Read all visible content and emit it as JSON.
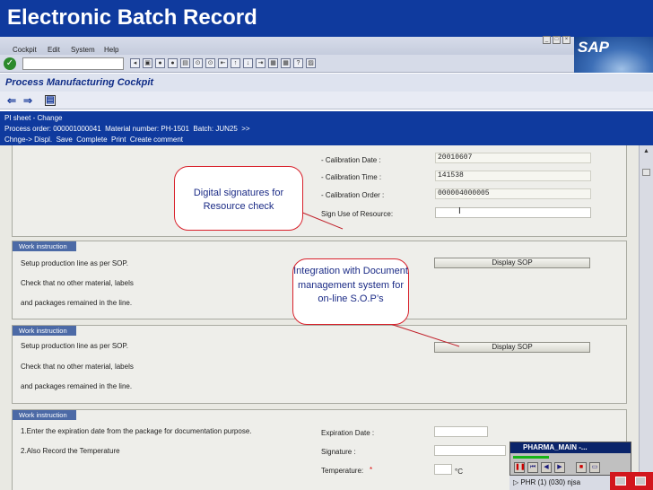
{
  "slide": {
    "title": "Electronic Batch Record"
  },
  "menu": {
    "items": [
      "Cockpit",
      "Edit",
      "System",
      "Help"
    ]
  },
  "logo": {
    "text": "SAP"
  },
  "toolbar": {
    "enter_icon": "check-icon",
    "icons": [
      "back-icon",
      "save-icon",
      "exit-icon",
      "cancel-icon",
      "print-icon",
      "find-icon",
      "find-next-icon",
      "first-page-icon",
      "prev-page-icon",
      "next-page-icon",
      "last-page-icon",
      "new-session-icon",
      "shortcut-icon",
      "help-icon",
      "layout-icon"
    ]
  },
  "app": {
    "title": "Process Manufacturing Cockpit"
  },
  "sheet": {
    "title": "PI sheet - Change",
    "process_order_label": "Process order:",
    "process_order": "000001000041",
    "material_label": "Material number:",
    "material": "PH-1501",
    "batch_label": "Batch:",
    "batch": "JUN25",
    "more": ">>",
    "actions": [
      "Chnge-> Displ.",
      "Save",
      "Complete",
      "Print",
      "Create comment"
    ]
  },
  "calibration": {
    "date_label": "- Calibration Date :",
    "date": "20010607",
    "time_label": "- Calibration Time :",
    "time": "141538",
    "order_label": "- Calibration Order :",
    "order": "000004000005",
    "sign_label": "Sign Use of Resource:",
    "sign_value": ""
  },
  "sections": [
    {
      "tab": "Work instruction",
      "lines": [
        "Setup production line as per SOP.",
        "Check that no other material, labels",
        "and packages remained in the line."
      ],
      "button": "Display SOP"
    },
    {
      "tab": "Work instruction",
      "lines": [
        "Setup production line as per SOP.",
        "Check that no other material, labels",
        "and packages remained in the line."
      ],
      "button": "Display SOP"
    },
    {
      "tab": "Work instruction",
      "lines": [
        "1.Enter the expiration date from the package for documentation purpose.",
        "2.Also Record the Temperature"
      ],
      "expiration_label": "Expiration Date :",
      "signature_label": "Signature :",
      "temperature_label": "Temperature:",
      "required_mark": "*",
      "unit": "°C"
    }
  ],
  "callouts": {
    "signatures": "Digital signatures for Resource check",
    "integration": "Integration with Document management system for on-line S.O.P’s"
  },
  "mini_window": {
    "title": "PHARMA_MAIN -...",
    "controls": [
      "pause-icon",
      "first-icon",
      "previous-icon",
      "next-icon",
      "stop-icon",
      "folder-icon"
    ]
  },
  "status": {
    "system": "PHR (1) (030)",
    "user": "njsa"
  }
}
